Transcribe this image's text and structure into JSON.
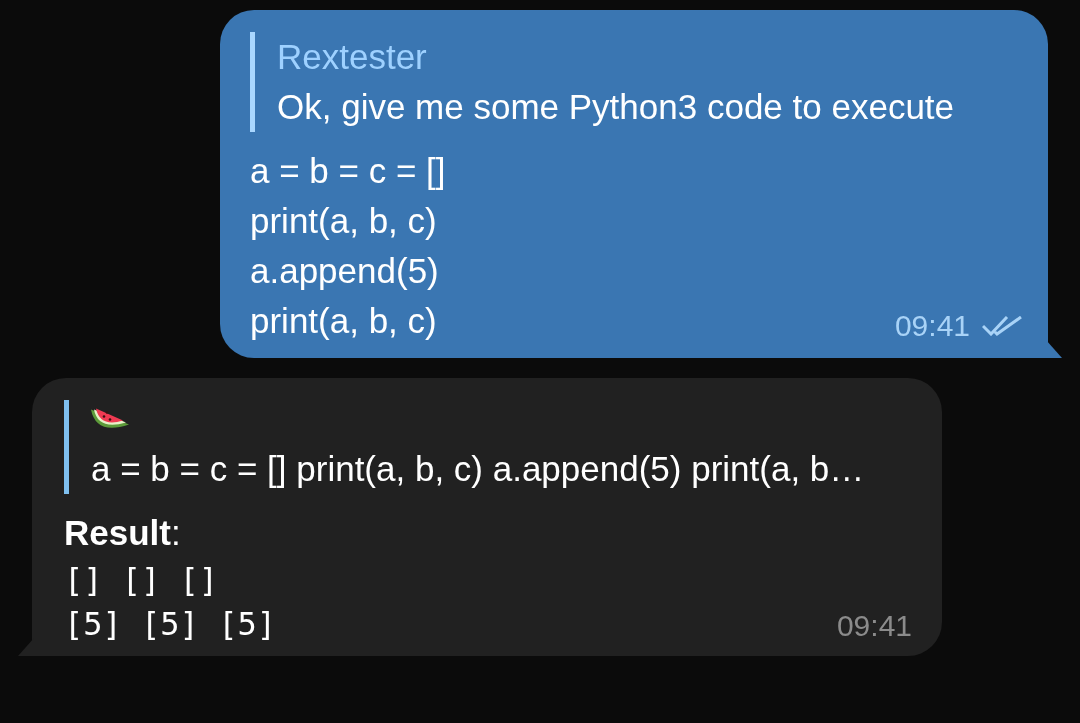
{
  "messages": [
    {
      "kind": "outgoing",
      "reply": {
        "author": "Rextester",
        "text": "Ok, give me some Python3 code to execute"
      },
      "lines": [
        "a = b = c = []",
        "print(a, b, c)",
        "a.append(5)",
        "print(a, b, c)"
      ],
      "time": "09:41",
      "read": true
    },
    {
      "kind": "incoming",
      "reply": {
        "emoji": true,
        "text": "a = b = c = [] print(a, b, c) a.append(5) print(a, b…"
      },
      "heading": "**Result**:",
      "mono_lines": [
        "[] [] []",
        "[5] [5] [5]"
      ],
      "time": "09:41"
    }
  ]
}
